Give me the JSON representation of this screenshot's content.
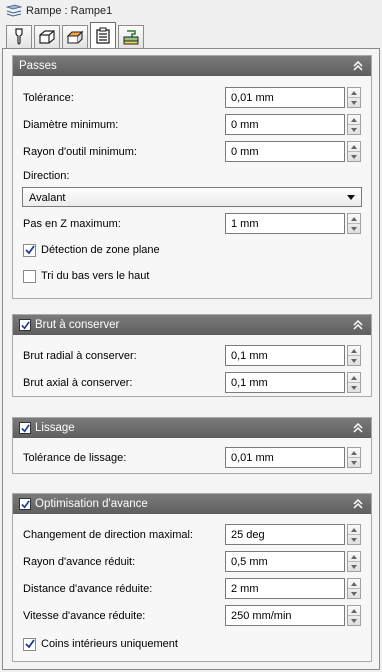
{
  "window": {
    "title": "Rampe : Rampe1",
    "title_icon": "layers-icon"
  },
  "tabs": [
    {
      "icon": "tool-icon",
      "active": false
    },
    {
      "icon": "stock-box-icon",
      "active": false
    },
    {
      "icon": "geometry-icon",
      "active": false
    },
    {
      "icon": "passes-icon",
      "active": true
    },
    {
      "icon": "linking-icon",
      "active": false
    }
  ],
  "groups": {
    "passes": {
      "title": "Passes",
      "tolerance": {
        "label": "Tolérance:",
        "value": "0,01 mm"
      },
      "min_diameter": {
        "label": "Diamètre minimum:",
        "value": "0 mm"
      },
      "min_radius": {
        "label": "Rayon d'outil minimum:",
        "value": "0 mm"
      },
      "direction": {
        "label": "Direction:",
        "value": "Avalant"
      },
      "max_z_step": {
        "label": "Pas en Z maximum:",
        "value": "1 mm"
      },
      "flat_detection": {
        "label": "Détection de zone plane",
        "checked": true
      },
      "bottom_up": {
        "label": "Tri du bas vers le haut",
        "checked": false
      }
    },
    "stock": {
      "title": "Brut à conserver",
      "enabled": true,
      "radial": {
        "label": "Brut radial à conserver:",
        "value": "0,1 mm"
      },
      "axial": {
        "label": "Brut axial à conserver:",
        "value": "0,1 mm"
      }
    },
    "smoothing": {
      "title": "Lissage",
      "enabled": true,
      "tolerance": {
        "label": "Tolérance de lissage:",
        "value": "0,01 mm"
      }
    },
    "feed_opt": {
      "title": "Optimisation d'avance",
      "enabled": true,
      "max_dir_change": {
        "label": "Changement de direction maximal:",
        "value": "25 deg"
      },
      "reduced_radius": {
        "label": "Rayon d'avance réduit:",
        "value": "0,5 mm"
      },
      "reduced_distance": {
        "label": "Distance d'avance réduite:",
        "value": "2 mm"
      },
      "reduced_rate": {
        "label": "Vitesse d'avance réduite:",
        "value": "250 mm/min"
      },
      "inner_corners": {
        "label": "Coins intérieurs uniquement",
        "checked": true
      }
    }
  }
}
